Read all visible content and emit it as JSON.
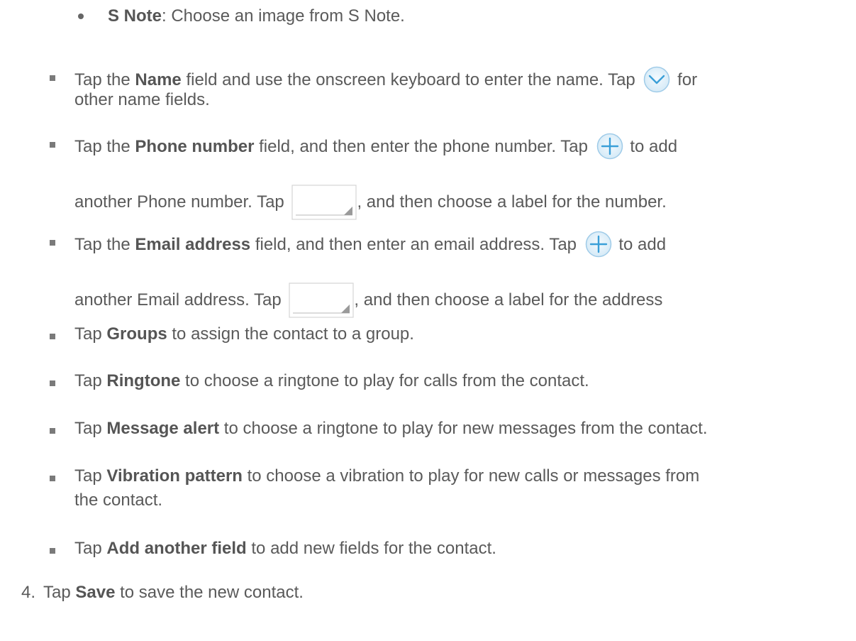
{
  "items": [
    {
      "bold": "S Note",
      "rest": ": Choose an image from S Note."
    },
    {
      "pre": "Tap the ",
      "bold": "Name",
      "mid": " field and use the onscreen keyboard to enter the name. Tap ",
      "post": " for",
      "line2": "other name fields."
    },
    {
      "pre": "Tap the ",
      "bold": "Phone number",
      "mid": " field, and then enter the phone number. Tap ",
      "post": " to add",
      "line2a": "another Phone number. Tap ",
      "line2b": ", and then choose a label for the number."
    },
    {
      "pre": "Tap the ",
      "bold": "Email address",
      "mid": " field, and then enter an email address. Tap ",
      "post": " to add",
      "line2a": "another Email address. Tap ",
      "line2b": ", and then choose a label for the address"
    },
    {
      "pre": "Tap ",
      "bold": "Groups",
      "rest": " to assign the contact to a group."
    },
    {
      "pre": "Tap ",
      "bold": "Ringtone",
      "rest": " to choose a ringtone to play for calls from the contact."
    },
    {
      "pre": "Tap ",
      "bold": "Message alert",
      "rest": " to choose a ringtone to play for new messages from the contact."
    },
    {
      "pre": "Tap ",
      "bold": "Vibration pattern",
      "rest": " to choose a vibration to play for new calls or messages from",
      "line2": "the contact."
    },
    {
      "pre": "Tap ",
      "bold": "Add another field",
      "rest": " to add new fields for the contact."
    }
  ],
  "step4": {
    "number": "4.",
    "pre": "Tap ",
    "bold": "Save",
    "rest": " to save the new contact."
  },
  "icons": {
    "expand": "chevron-down-circle-icon",
    "add": "plus-circle-icon",
    "label_dropdown": "dropdown-corner-icon"
  },
  "colors": {
    "text": "#5a5a5a",
    "icon_blue": "#3a9fd8",
    "icon_blue_light": "#d8ecf8"
  }
}
